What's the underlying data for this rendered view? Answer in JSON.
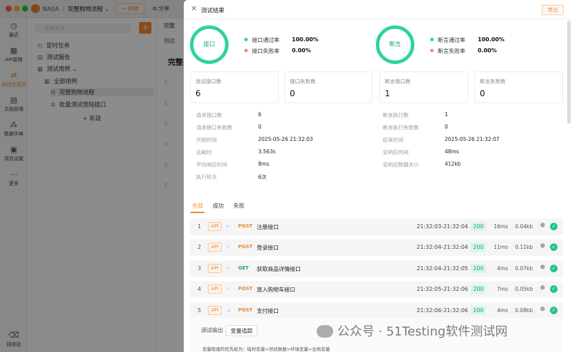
{
  "app": {
    "org": "NASA",
    "project": "完整购物流程",
    "new_label": "+ 新建",
    "share_label": "分享",
    "nav": [
      {
        "label": "最近",
        "icon": "clock-icon",
        "glyph": "◷"
      },
      {
        "label": "API管理",
        "icon": "api-icon",
        "glyph": "▦"
      },
      {
        "label": "自动化测试",
        "icon": "automation-icon",
        "glyph": "⇄"
      },
      {
        "label": "文档管理",
        "icon": "doc-icon",
        "glyph": "▤"
      },
      {
        "label": "数据字典",
        "icon": "dictionary-icon",
        "glyph": "⁂"
      },
      {
        "label": "项目设置",
        "icon": "settings-icon",
        "glyph": "▣"
      },
      {
        "label": "更多",
        "icon": "more-icon",
        "glyph": "⋯"
      },
      {
        "label": "回收站",
        "icon": "trash-icon",
        "glyph": "⌫"
      }
    ],
    "search_placeholder": "目录/任务",
    "tree": {
      "scheduled": "定时任务",
      "report": "测试报告",
      "cases": "测试用例",
      "all": "全部用例",
      "case1": "完整购物流程",
      "case2": "批量测试登陆接口",
      "new": "+ 新建"
    },
    "content_tab": "完整",
    "content_tab2": "测试",
    "content_heading": "完整"
  },
  "drawer": {
    "title": "测试结果",
    "export_label": "导出",
    "interface_ring": "接口",
    "assert_ring": "断言",
    "interface_pass_label": "接口通过率",
    "interface_pass_value": "100.00%",
    "interface_fail_label": "接口失败率",
    "interface_fail_value": "0.00%",
    "assert_pass_label": "断言通过率",
    "assert_pass_value": "100.00%",
    "assert_fail_label": "断言失败率",
    "assert_fail_value": "0.00%",
    "cards": [
      {
        "label": "测试接口数",
        "value": "6"
      },
      {
        "label": "接口失败数",
        "value": "0"
      },
      {
        "label": "断言接口数",
        "value": "1"
      },
      {
        "label": "断言失败数",
        "value": "0"
      }
    ],
    "left_kv": [
      {
        "label": "请求接口数",
        "value": "6"
      },
      {
        "label": "请求接口失败数",
        "value": "0"
      },
      {
        "label": "开始时间",
        "value": "2025-05-26 21:32:03"
      },
      {
        "label": "总耗时",
        "value": "3.563s"
      },
      {
        "label": "平均响应时间",
        "value": "8ms"
      },
      {
        "label": "执行轮次",
        "value": "6次"
      }
    ],
    "right_kv": [
      {
        "label": "断言执行数",
        "value": "1"
      },
      {
        "label": "断言执行失败数",
        "value": "0"
      },
      {
        "label": "结束时间",
        "value": "2025-05-26 21:32:07"
      },
      {
        "label": "总响应时间",
        "value": "48ms"
      },
      {
        "label": "总响应数据大小",
        "value": "412kb"
      }
    ],
    "result_tabs": [
      "全部",
      "成功",
      "失败"
    ],
    "requests": [
      {
        "num": "1",
        "tag": "API",
        "method": "POST",
        "name": "注册接口",
        "time": "21:32:03-21:32:04",
        "code": "200",
        "ms": "16ms",
        "size": "0.04kb"
      },
      {
        "num": "2",
        "tag": "API",
        "method": "POST",
        "name": "登录接口",
        "time": "21:32:04-21:32:04",
        "code": "200",
        "ms": "11ms",
        "size": "0.11kb"
      },
      {
        "num": "3",
        "tag": "API",
        "method": "GET",
        "name": "获取商品详情接口",
        "time": "21:32:04-21:32:05",
        "code": "200",
        "ms": "4ms",
        "size": "0.07kb"
      },
      {
        "num": "4",
        "tag": "API",
        "method": "POST",
        "name": "放入购物车接口",
        "time": "21:32:05-21:32:06",
        "code": "200",
        "ms": "7ms",
        "size": "0.05kb"
      },
      {
        "num": "5",
        "tag": "API",
        "method": "POST",
        "name": "支付接口",
        "time": "21:32:06-21:32:06",
        "code": "200",
        "ms": "4ms",
        "size": "0.08kb"
      }
    ],
    "sub_tabs": [
      "调试输出",
      "变量追踪"
    ],
    "hint": "变量取值的优先级为：临时变量>测试数据>环境变量>全局变量",
    "watermark": "公众号 · 51Testing软件测试网"
  },
  "colors": {
    "accent": "#e8882e",
    "success": "#2ed2a0",
    "fail_dot": "#f28b6e",
    "post": "#e8882e",
    "get": "#1aa57c"
  }
}
